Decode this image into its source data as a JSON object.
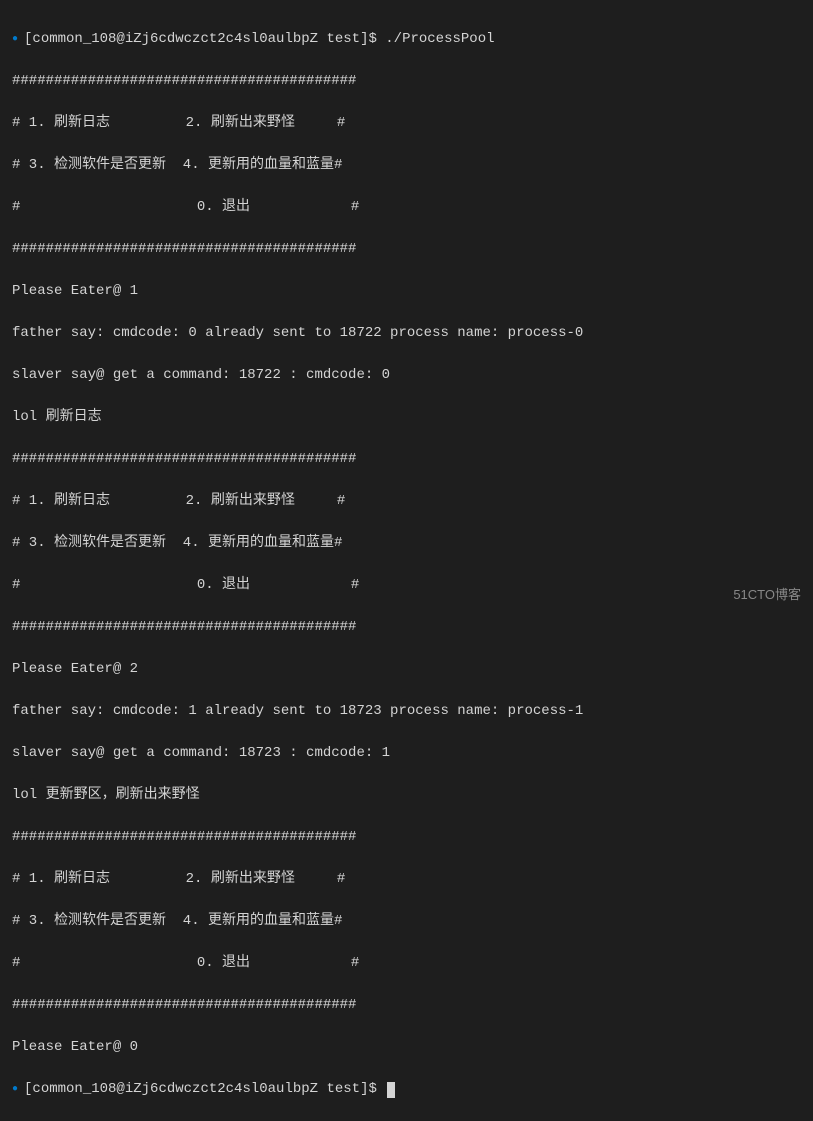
{
  "prompt1": "[common_108@iZj6cdwczct2c4sl0aulbpZ test]$ ./ProcessPool",
  "menu_divider": "#########################################",
  "menu_line1": "# 1. 刷新日志         2. 刷新出来野怪     #",
  "menu_line2": "# 3. 检测软件是否更新  4. 更新用的血量和蓝量#",
  "menu_line3": "#                     0. 退出            #",
  "input1": "Please Eater@ 1",
  "father1": "father say: cmdcode: 0 already sent to 18722 process name: process-0",
  "slaver1": "slaver say@ get a command: 18722 : cmdcode: 0",
  "lol1": "lol 刷新日志",
  "input2": "Please Eater@ 2",
  "father2": "father say: cmdcode: 1 already sent to 18723 process name: process-1",
  "slaver2": "slaver say@ get a command: 18723 : cmdcode: 1",
  "lol2": "lol 更新野区，刷新出来野怪",
  "input3": "Please Eater@ 0",
  "prompt2": "[common_108@iZj6cdwczct2c4sl0aulbpZ test]$ ",
  "watermark": "51CTO博客"
}
